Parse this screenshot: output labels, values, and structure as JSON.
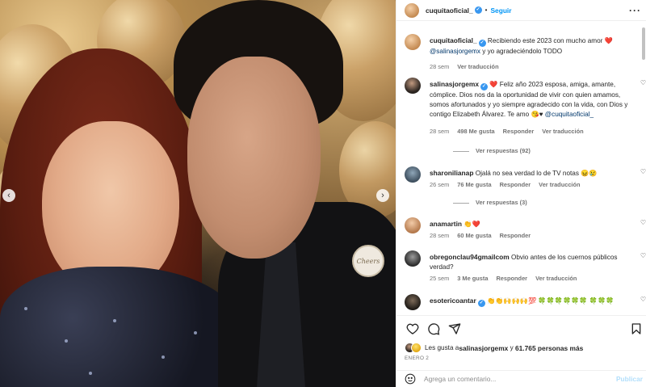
{
  "post": {
    "prev_icon": "chevron-left-icon",
    "next_icon": "chevron-right-icon",
    "pin_text": "Cheers"
  },
  "header": {
    "username": "cuquitaoficial_",
    "separator": "•",
    "follow_label": "Seguir",
    "more_label": "···"
  },
  "caption": {
    "username": "cuquitaoficial_",
    "text_before": " Recibiendo este 2023 con mucho amor ❤️ ",
    "mention": "@salinasjorgemx",
    "text_after": " y yo agradeciéndolo TODO",
    "time": "28 sem",
    "translate": "Ver traducción"
  },
  "comments": [
    {
      "username": "salinasjorgemx",
      "text_before": " ❤️ Feliz año 2023 esposa, amiga, amante, cómplice. Dios nos da la oportunidad de vivir con quien amamos, somos afortunados y yo siempre agradecido con la vida, con Dios y contigo Elizabeth Álvarez. Te amo 😘♥ ",
      "mention": "@cuquitaoficial_",
      "time": "28 sem",
      "likes": "498 Me gusta",
      "reply": "Responder",
      "translate": "Ver traducción",
      "replies": "Ver respuestas (92)"
    },
    {
      "username": "sharonilianap",
      "text": " Ojalá no sea verdad lo de TV notas 😖😢",
      "time": "26 sem",
      "likes": "76 Me gusta",
      "reply": "Responder",
      "translate": "Ver traducción",
      "replies": "Ver respuestas (3)"
    },
    {
      "username": "anamartin",
      "text": " 👏❤️",
      "time": "28 sem",
      "likes": "60 Me gusta",
      "reply": "Responder"
    },
    {
      "username": "obregonclau94gmailcom",
      "text": " Obvio antes de los cuernos públicos verdad?",
      "time": "25 sem",
      "likes": "3 Me gusta",
      "reply": "Responder",
      "translate": "Ver traducción"
    },
    {
      "username": "esotericoantar",
      "text": " 👏👏🙌🙌🙌💯 🍀🍀🍀🍀🍀🍀 🍀🍀🍀"
    }
  ],
  "actions": {
    "like_icon": "heart-icon",
    "comment_icon": "comment-icon",
    "share_icon": "paper-plane-icon",
    "save_icon": "bookmark-icon"
  },
  "likes": {
    "prefix": "Les gusta a ",
    "user": "salinasjorgemx",
    "middle": " y ",
    "count": "61.765 personas más"
  },
  "date": "ENERO 2",
  "composer": {
    "emoji_icon": "smiley-icon",
    "placeholder": "Agrega un comentario...",
    "publish_label": "Publicar"
  },
  "colors": {
    "accent": "#0095f6",
    "verified": "#3897f0",
    "heart": "#ed4956",
    "muted": "#737373"
  }
}
